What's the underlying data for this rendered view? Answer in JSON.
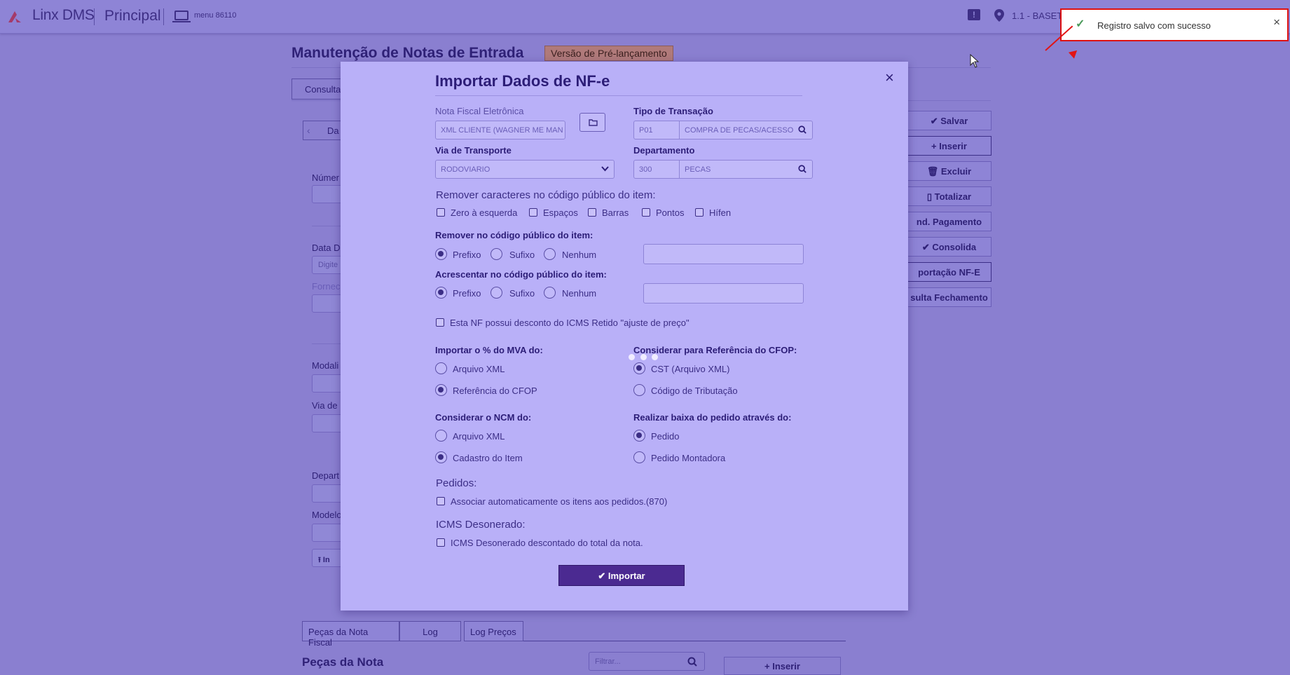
{
  "topbar": {
    "brand": "Linx DMS",
    "section": "Principal",
    "menu_label": "menu 86110",
    "location": "1.1 - BASET"
  },
  "toast": {
    "message": "Registro salvo com sucesso",
    "close": "×"
  },
  "page": {
    "title": "Manutenção de Notas de Entrada",
    "badge": "Versão de Pré-lançamento",
    "consulta_tab": "Consulta",
    "da_tab": "Da",
    "labels": {
      "numero": "Númer",
      "data": "Data D",
      "data_placeholder": "Digite",
      "fornecedor": "Fornec",
      "modalidade": "Modali",
      "via": "Via de",
      "departamento": "Depart",
      "modelo": "Modelo",
      "insert_small": "In"
    },
    "right_buttons": [
      "Salvar",
      "Inserir",
      "Excluir",
      "Totalizar",
      "nd. Pagamento",
      "Consolida",
      "portação NF-E",
      "sulta Fechamento"
    ],
    "bottom_tabs": [
      "Peças da Nota Fiscal",
      "Log",
      "Log Preços"
    ],
    "bottom_title": "Peças da Nota",
    "filter_placeholder": "Filtrar...",
    "bottom_insert": "Inserir"
  },
  "modal": {
    "title": "Importar Dados de NF-e",
    "close": "×",
    "nfe": {
      "label": "Nota Fiscal Eletrônica",
      "value": "XML CLIENTE (WAGNER ME MAN"
    },
    "tipo_transacao": {
      "label": "Tipo de Transação",
      "code": "P01",
      "desc": "COMPRA DE PECAS/ACESSOR"
    },
    "via_transporte": {
      "label": "Via de Transporte",
      "value": "RODOVIARIO"
    },
    "departamento": {
      "label": "Departamento",
      "code": "300",
      "desc": "PECAS"
    },
    "remover_caracteres": {
      "title": "Remover caracteres no código público do item:",
      "options": [
        "Zero à esquerda",
        "Espaços",
        "Barras",
        "Pontos",
        "Hífen"
      ]
    },
    "remover_codigo": {
      "title": "Remover no código público do item:",
      "options": [
        "Prefixo",
        "Sufixo",
        "Nenhum"
      ],
      "selected": "Prefixo"
    },
    "acrescentar_codigo": {
      "title": "Acrescentar no código público do item:",
      "options": [
        "Prefixo",
        "Sufixo",
        "Nenhum"
      ],
      "selected": "Prefixo"
    },
    "icms_retido": "Esta NF possui desconto do ICMS Retido \"ajuste de preço\"",
    "mva": {
      "title": "Importar o % do MVA do:",
      "options": [
        "Arquivo XML",
        "Referência do CFOP"
      ],
      "selected": "Referência do CFOP"
    },
    "cfop": {
      "title": "Considerar para Referência do CFOP:",
      "options": [
        "CST (Arquivo XML)",
        "Código de Tributação"
      ],
      "selected": "CST (Arquivo XML)"
    },
    "ncm": {
      "title": "Considerar o NCM do:",
      "options": [
        "Arquivo XML",
        "Cadastro do Item"
      ],
      "selected": "Cadastro do Item"
    },
    "baixa": {
      "title": "Realizar baixa do pedido através do:",
      "options": [
        "Pedido",
        "Pedido Montadora"
      ],
      "selected": "Pedido"
    },
    "pedidos": {
      "title": "Pedidos:",
      "checkbox": "Associar automaticamente os itens aos pedidos.(870)"
    },
    "icms_desonerado": {
      "title": "ICMS Desonerado:",
      "checkbox": "ICMS Desonerado descontado do total da nota."
    },
    "import_button": "Importar"
  },
  "colors": {
    "overlay": "#8a7fd0",
    "modal_bg": "#b9b0f8",
    "primary": "#4b2a91",
    "highlight_red": "#e21414"
  }
}
